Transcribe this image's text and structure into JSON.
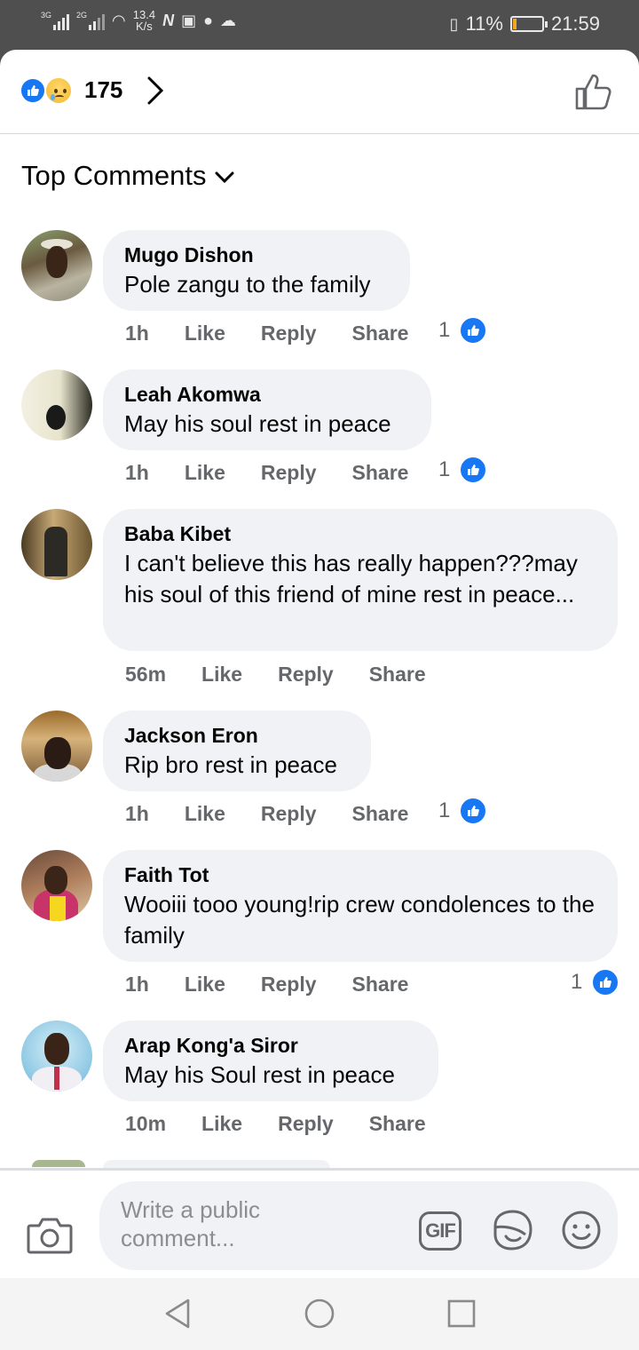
{
  "status_bar": {
    "net1": "3G",
    "net2": "2G",
    "speed_value": "13.4",
    "speed_unit": "K/s",
    "battery_percent": "11%",
    "battery_level": 0.11,
    "time": "21:59"
  },
  "reactions": {
    "icons": [
      "like-icon",
      "sad-face-icon"
    ],
    "count": "175"
  },
  "sort": {
    "label": "Top Comments"
  },
  "comments": [
    {
      "name": "Mugo Dishon",
      "text": "Pole zangu to the family",
      "time": "1h",
      "like": "Like",
      "reply": "Reply",
      "share": "Share",
      "likes": "1"
    },
    {
      "name": "Leah Akomwa",
      "text": "May his soul rest in peace",
      "time": "1h",
      "like": "Like",
      "reply": "Reply",
      "share": "Share",
      "likes": "1"
    },
    {
      "name": "Baba Kibet",
      "text": "I can't believe this has really happen???may his soul of this friend of mine rest in peace...",
      "time": "56m",
      "like": "Like",
      "reply": "Reply",
      "share": "Share",
      "likes": ""
    },
    {
      "name": "Jackson Eron",
      "text": "Rip bro rest in peace",
      "time": "1h",
      "like": "Like",
      "reply": "Reply",
      "share": "Share",
      "likes": "1"
    },
    {
      "name": "Faith Tot",
      "text": "Wooiii tooo young!rip crew condolences to the family",
      "time": "1h",
      "like": "Like",
      "reply": "Reply",
      "share": "Share",
      "likes": "1"
    },
    {
      "name": "Arap Kong'a Siror",
      "text": "May his Soul rest in peace",
      "time": "10m",
      "like": "Like",
      "reply": "Reply",
      "share": "Share",
      "likes": ""
    }
  ],
  "composer": {
    "placeholder": "Write a public comment...",
    "gif_label": "GIF",
    "icons": [
      "camera-icon",
      "gif-icon",
      "sticker-icon",
      "emoji-icon"
    ]
  },
  "nav_bar": {
    "icons": [
      "back-icon",
      "home-icon",
      "recents-icon"
    ]
  },
  "colors": {
    "accent": "#1877f2",
    "bubble": "#f0f2f5",
    "secondary_text": "#65676b",
    "status_bar": "#4f4f4f",
    "battery_low": "#f5a623"
  }
}
